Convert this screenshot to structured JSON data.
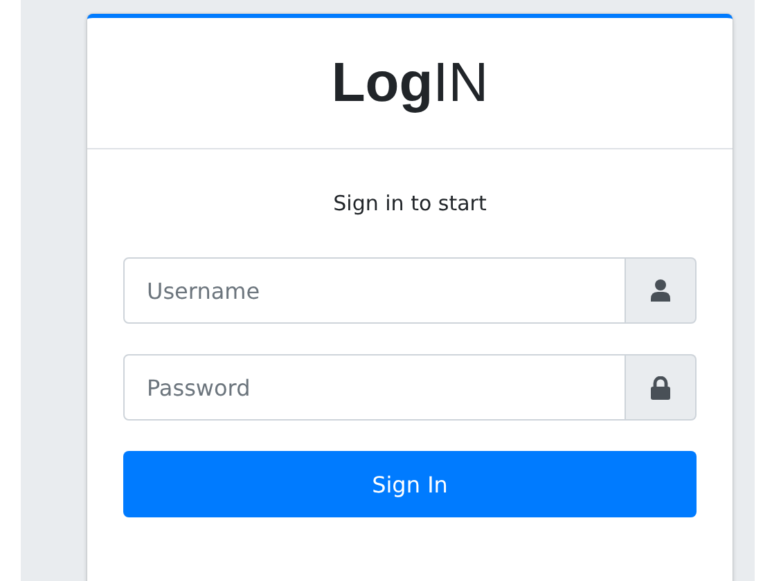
{
  "logo": "**Log**IN",
  "message": "Sign in to start",
  "fields": [
    {
      "placeholder": "Username",
      "kind": "user"
    },
    {
      "placeholder": "Password",
      "kind": "lock"
    }
  ],
  "button": "Sign In"
}
